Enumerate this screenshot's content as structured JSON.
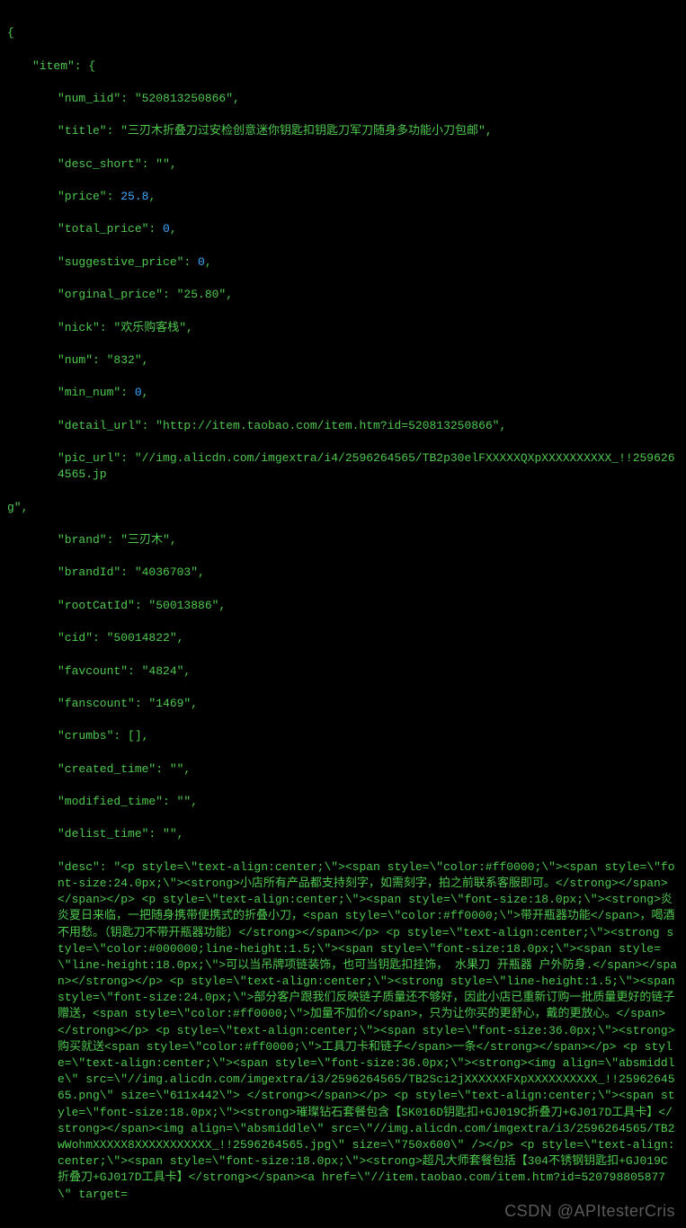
{
  "json_view": {
    "open_brace": "{",
    "item_key": "\"item\": {",
    "fields": {
      "num_iid": "\"num_iid\": \"520813250866\",",
      "title": "\"title\": \"三刃木折叠刀过安检创意迷你钥匙扣钥匙刀军刀随身多功能小刀包邮\",",
      "desc_short": "\"desc_short\": \"\",",
      "price_k": "\"price\": ",
      "price_v": "25.8",
      "price_t": ",",
      "total_price_k": "\"total_price\": ",
      "total_price_v": "0",
      "total_price_t": ",",
      "sugg_price_k": "\"suggestive_price\": ",
      "sugg_price_v": "0",
      "sugg_price_t": ",",
      "orginal_price": "\"orginal_price\": \"25.80\",",
      "nick": "\"nick\": \"欢乐购客栈\",",
      "num": "\"num\": \"832\",",
      "min_num_k": "\"min_num\": ",
      "min_num_v": "0",
      "min_num_t": ",",
      "detail_url": "\"detail_url\": \"http://item.taobao.com/item.htm?id=520813250866\",",
      "pic_url_a": "\"pic_url\": \"//img.alicdn.com/imgextra/i4/2596264565/TB2p30elFXXXXXQXpXXXXXXXXXX_!!2596264565.jp",
      "pic_url_b": "g\",",
      "brand": "\"brand\": \"三刃木\",",
      "brandId": "\"brandId\": \"4036703\",",
      "rootCatId": "\"rootCatId\": \"50013886\",",
      "cid": "\"cid\": \"50014822\",",
      "favcount": "\"favcount\": \"4824\",",
      "fanscount": "\"fanscount\": \"1469\",",
      "crumbs": "\"crumbs\": [],",
      "created_time": "\"created_time\": \"\",",
      "modified_time": "\"modified_time\": \"\",",
      "delist_time": "\"delist_time\": \"\",",
      "desc": "\"desc\": \"<p style=\\\"text-align:center;\\\"><span style=\\\"color:#ff0000;\\\"><span style=\\\"font-size:24.0px;\\\"><strong>小店所有产品都支持刻字，如需刻字，拍之前联系客服即可。</strong></span></span></p> <p style=\\\"text-align:center;\\\"><span style=\\\"font-size:18.0px;\\\"><strong>炎炎夏日来临，一把随身携带便携式的折叠小刀，<span style=\\\"color:#ff0000;\\\">带开瓶器功能</span>，喝酒不用愁。（钥匙刀不带开瓶器功能）</strong></span></p> <p style=\\\"text-align:center;\\\"><strong style=\\\"color:#000000;line-height:1.5;\\\"><span style=\\\"font-size:18.0px;\\\"><span style=\\\"line-height:18.0px;\\\">可以当吊牌项链装饰，也可当钥匙扣挂饰， 水果刀 开瓶器 户外防身.</span></span></strong></p> <p style=\\\"text-align:center;\\\"><strong style=\\\"line-height:1.5;\\\"><span style=\\\"font-size:24.0px;\\\">部分客户跟我们反映链子质量还不够好，因此小店已重新订购一批质量更好的链子赠送，<span style=\\\"color:#ff0000;\\\">加量不加价</span>，只为让你买的更舒心，戴的更放心。</span></strong></p> <p style=\\\"text-align:center;\\\"><span style=\\\"font-size:36.0px;\\\"><strong>购买就送<span style=\\\"color:#ff0000;\\\">工具刀卡和链子</span>一条</strong></span></p> <p style=\\\"text-align:center;\\\"><span style=\\\"font-size:36.0px;\\\"><strong><img align=\\\"absmiddle\\\" src=\\\"//img.alicdn.com/imgextra/i3/2596264565/TB2Sci2jXXXXXXFXpXXXXXXXXXX_!!2596264565.png\\\" size=\\\"611x442\\\"> </strong></span></p> <p style=\\\"text-align:center;\\\"><span style=\\\"font-size:18.0px;\\\"><strong>璀璨钻石套餐包含【SK016D钥匙扣+GJ019C折叠刀+GJ017D工具卡】</strong></span><img align=\\\"absmiddle\\\" src=\\\"//img.alicdn.com/imgextra/i3/2596264565/TB2wWohmXXXXX8XXXXXXXXXXX_!!2596264565.jpg\\\" size=\\\"750x600\\\" /></p> <p style=\\\"text-align:center;\\\"><span style=\\\"font-size:18.0px;\\\"><strong>超凡大师套餐包括【304不锈钢钥匙扣+GJ019C折叠刀+GJ017D工具卡】</strong></span><a href=\\\"//item.taobao.com/item.htm?id=520798805877\\\" target="
    }
  },
  "watermark": "CSDN @APItesterCris"
}
